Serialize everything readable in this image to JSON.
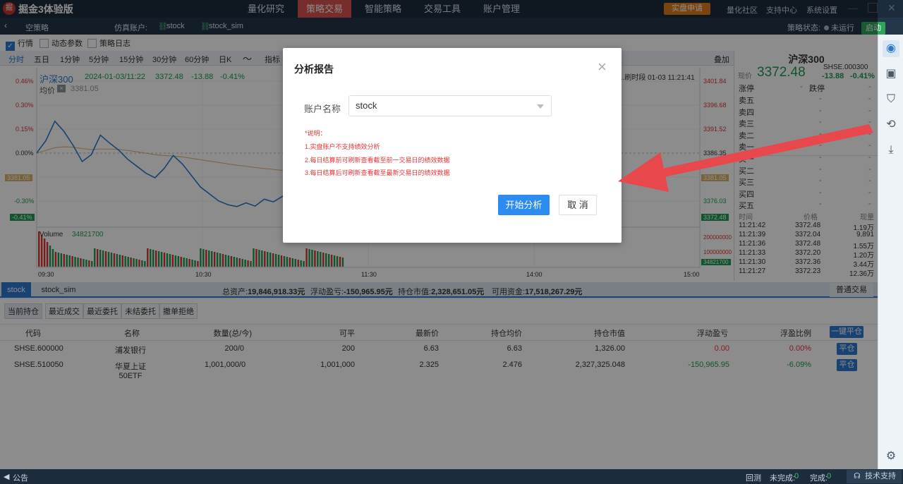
{
  "app": {
    "logo": "掘",
    "title": "掘金3体验版"
  },
  "menu": [
    "量化研究",
    "策略交易",
    "智能策略",
    "交易工具",
    "账户管理"
  ],
  "top_right": {
    "live_apply": "实盘申请",
    "links": [
      "量化社区",
      "支持中心",
      "系统设置"
    ]
  },
  "subbar": {
    "strategy": "空策略",
    "sim_label": "仿真账户:",
    "accounts": [
      "stock",
      "stock_sim"
    ],
    "status_label": "策略状态:",
    "status_value": "未运行",
    "start": "启动"
  },
  "options": {
    "market": "行情",
    "params": "动态参数",
    "log": "策略日志"
  },
  "periods": [
    "分时",
    "五日",
    "1分钟",
    "5分钟",
    "15分钟",
    "30分钟",
    "60分钟",
    "日K",
    "〜",
    "指标"
  ],
  "overlay_label": "叠加",
  "quote": {
    "name": "沪深300",
    "datetime": "2024-01-03/11:22",
    "price": "3372.48",
    "change": "-13.88",
    "change_pct": "-0.41%",
    "avg_label": "均价",
    "avg_value": "3381.05",
    "time_info": "...刷时段 01-03 11:21:41",
    "symbol": "SHSE.000300",
    "price_label": "现价"
  },
  "chart_data": {
    "type": "line",
    "left_ticks": [
      "0.46%",
      "0.30%",
      "0.15%",
      "0.00%",
      "-0.30%",
      "-0.41%"
    ],
    "left_tag": "3381.05",
    "right_ticks": [
      "3401.84",
      "3396.68",
      "3391.52",
      "3386.35",
      "3376.03"
    ],
    "right_tags": [
      "3381.05",
      "3372.48"
    ],
    "x_ticks": [
      "09:30",
      "10:30",
      "11:30",
      "14:00",
      "15:00"
    ],
    "volume_label": "Volume",
    "volume_value": "34821700",
    "volume_ticks": [
      "200000000",
      "100000000"
    ],
    "volume_tag": "34821700",
    "price_series": [
      3386.35,
      3389,
      3393.2,
      3391,
      3388,
      3384.5,
      3386,
      3390.2,
      3388.5,
      3387,
      3385,
      3383.5,
      3382,
      3381,
      3383,
      3385.8,
      3384,
      3381.5,
      3379,
      3377.5,
      3376,
      3375.2,
      3374.8,
      3375.6,
      3374.9,
      3376.4,
      3375.8,
      3377,
      3376.3,
      3378,
      3377.6,
      3379.5,
      3380.8,
      3382.1,
      3383.4
    ],
    "avg_series": [
      3386.35,
      3386.9,
      3387.5,
      3387.7,
      3387.6,
      3387.3,
      3387.1,
      3387.2,
      3387.2,
      3387.1,
      3386.9,
      3386.6,
      3386.3,
      3386,
      3385.8,
      3385.7,
      3385.5,
      3385.2,
      3384.9,
      3384.6,
      3384.3,
      3384,
      3383.7,
      3383.5,
      3383.2,
      3383,
      3382.8,
      3382.6,
      3382.4,
      3382.2,
      3382,
      3381.8,
      3381.6,
      3381.4,
      3381.2
    ]
  },
  "orderbook": {
    "limit_up": "涨停",
    "limit_down": "跌停",
    "asks": [
      "卖五",
      "卖四",
      "卖三",
      "卖二",
      "卖一"
    ],
    "bids": [
      "买一",
      "买二",
      "买三",
      "买四",
      "买五"
    ]
  },
  "ticks": {
    "headers": [
      "时间",
      "价格",
      "现量"
    ],
    "rows": [
      [
        "11:21:42",
        "3372.48",
        "1.19万"
      ],
      [
        "11:21:39",
        "3372.04",
        "9,891"
      ],
      [
        "11:21:36",
        "3372.48",
        "1.55万"
      ],
      [
        "11:21:33",
        "3372.20",
        "1.20万"
      ],
      [
        "11:21:30",
        "3372.36",
        "3.44万"
      ],
      [
        "11:21:27",
        "3372.23",
        "12.36万"
      ]
    ]
  },
  "account_bar": {
    "tabs": [
      "stock",
      "stock_sim"
    ],
    "total_label": "总资产:",
    "total": "19,846,918.33元",
    "pnl_label": "浮动盈亏:",
    "pnl": "-150,965.95元",
    "mv_label": "持仓市值:",
    "mv": "2,328,651.05元",
    "cash_label": "可用资金:",
    "cash": "17,518,267.29元",
    "mode": "普通交易"
  },
  "position_tabs": [
    "当前持仓",
    "最近成交",
    "最近委托",
    "未结委托",
    "撤单拒绝"
  ],
  "positions": {
    "headers": [
      "代码",
      "名称",
      "数量(总/今)",
      "可平",
      "最新价",
      "持仓均价",
      "持仓市值",
      "浮动盈亏",
      "浮盈比例"
    ],
    "close_all": "一键平仓",
    "close": "平仓",
    "rows": [
      [
        "SHSE.600000",
        "浦发银行",
        "200/0",
        "200",
        "6.63",
        "6.63",
        "1,326.00",
        "0.00",
        "0.00%"
      ],
      [
        "SHSE.510050",
        "华夏上证50ETF",
        "1,001,000/0",
        "1,001,000",
        "2.325",
        "2.476",
        "2,327,325.048",
        "-150,965.95",
        "-6.09%"
      ]
    ]
  },
  "bottom": {
    "notice": "公告",
    "review": "回测",
    "pending_label": "未完成:",
    "pending": "0",
    "done_label": "完成:",
    "done": "0",
    "support": "技术支持"
  },
  "modal": {
    "title": "分析报告",
    "close": "×",
    "account_label": "账户名称",
    "account_value": "stock",
    "notes": [
      "*说明：",
      "1.实盘账户不支持绩效分析",
      "2.每日结算前可刷新查看截至前一交易日的绩效数据",
      "3.每日结算后可刷新查看截至最新交易日的绩效数据"
    ],
    "analyze": "开始分析",
    "cancel": "取 消"
  },
  "colors": {
    "accent": "#2b78d0",
    "rise": "#dd3333",
    "fall": "#1f9a52",
    "arrow": "#e8484b"
  }
}
